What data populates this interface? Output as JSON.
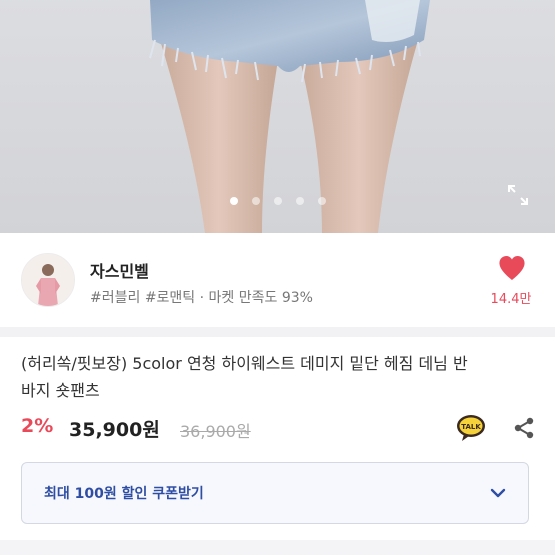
{
  "gallery": {
    "dot_count": 5,
    "active_index": 0
  },
  "seller": {
    "name": "자스민벨",
    "tags": "#러블리 #로맨틱 · 마켓 만족도 93%",
    "like_count": "14.4만"
  },
  "product": {
    "title_line1": "(허리쏙/핏보장) 5color 연청 하이웨스트 데미지 밑단 헤짐 데님 반",
    "title_line2": "바지 숏팬츠",
    "discount": "2%",
    "price": "35,900원",
    "original_price": "36,900원"
  },
  "coupon": {
    "label": "최대 100원 할인 쿠폰받기"
  },
  "icons": {
    "heart": "heart-icon",
    "talk": "kakao-talk-icon",
    "share": "share-icon",
    "expand": "expand-icon",
    "chevron": "chevron-down-icon"
  },
  "colors": {
    "accent_red": "#e94a5a",
    "coupon_blue": "#2f4ea3",
    "talk_yellow": "#f5d23a"
  }
}
